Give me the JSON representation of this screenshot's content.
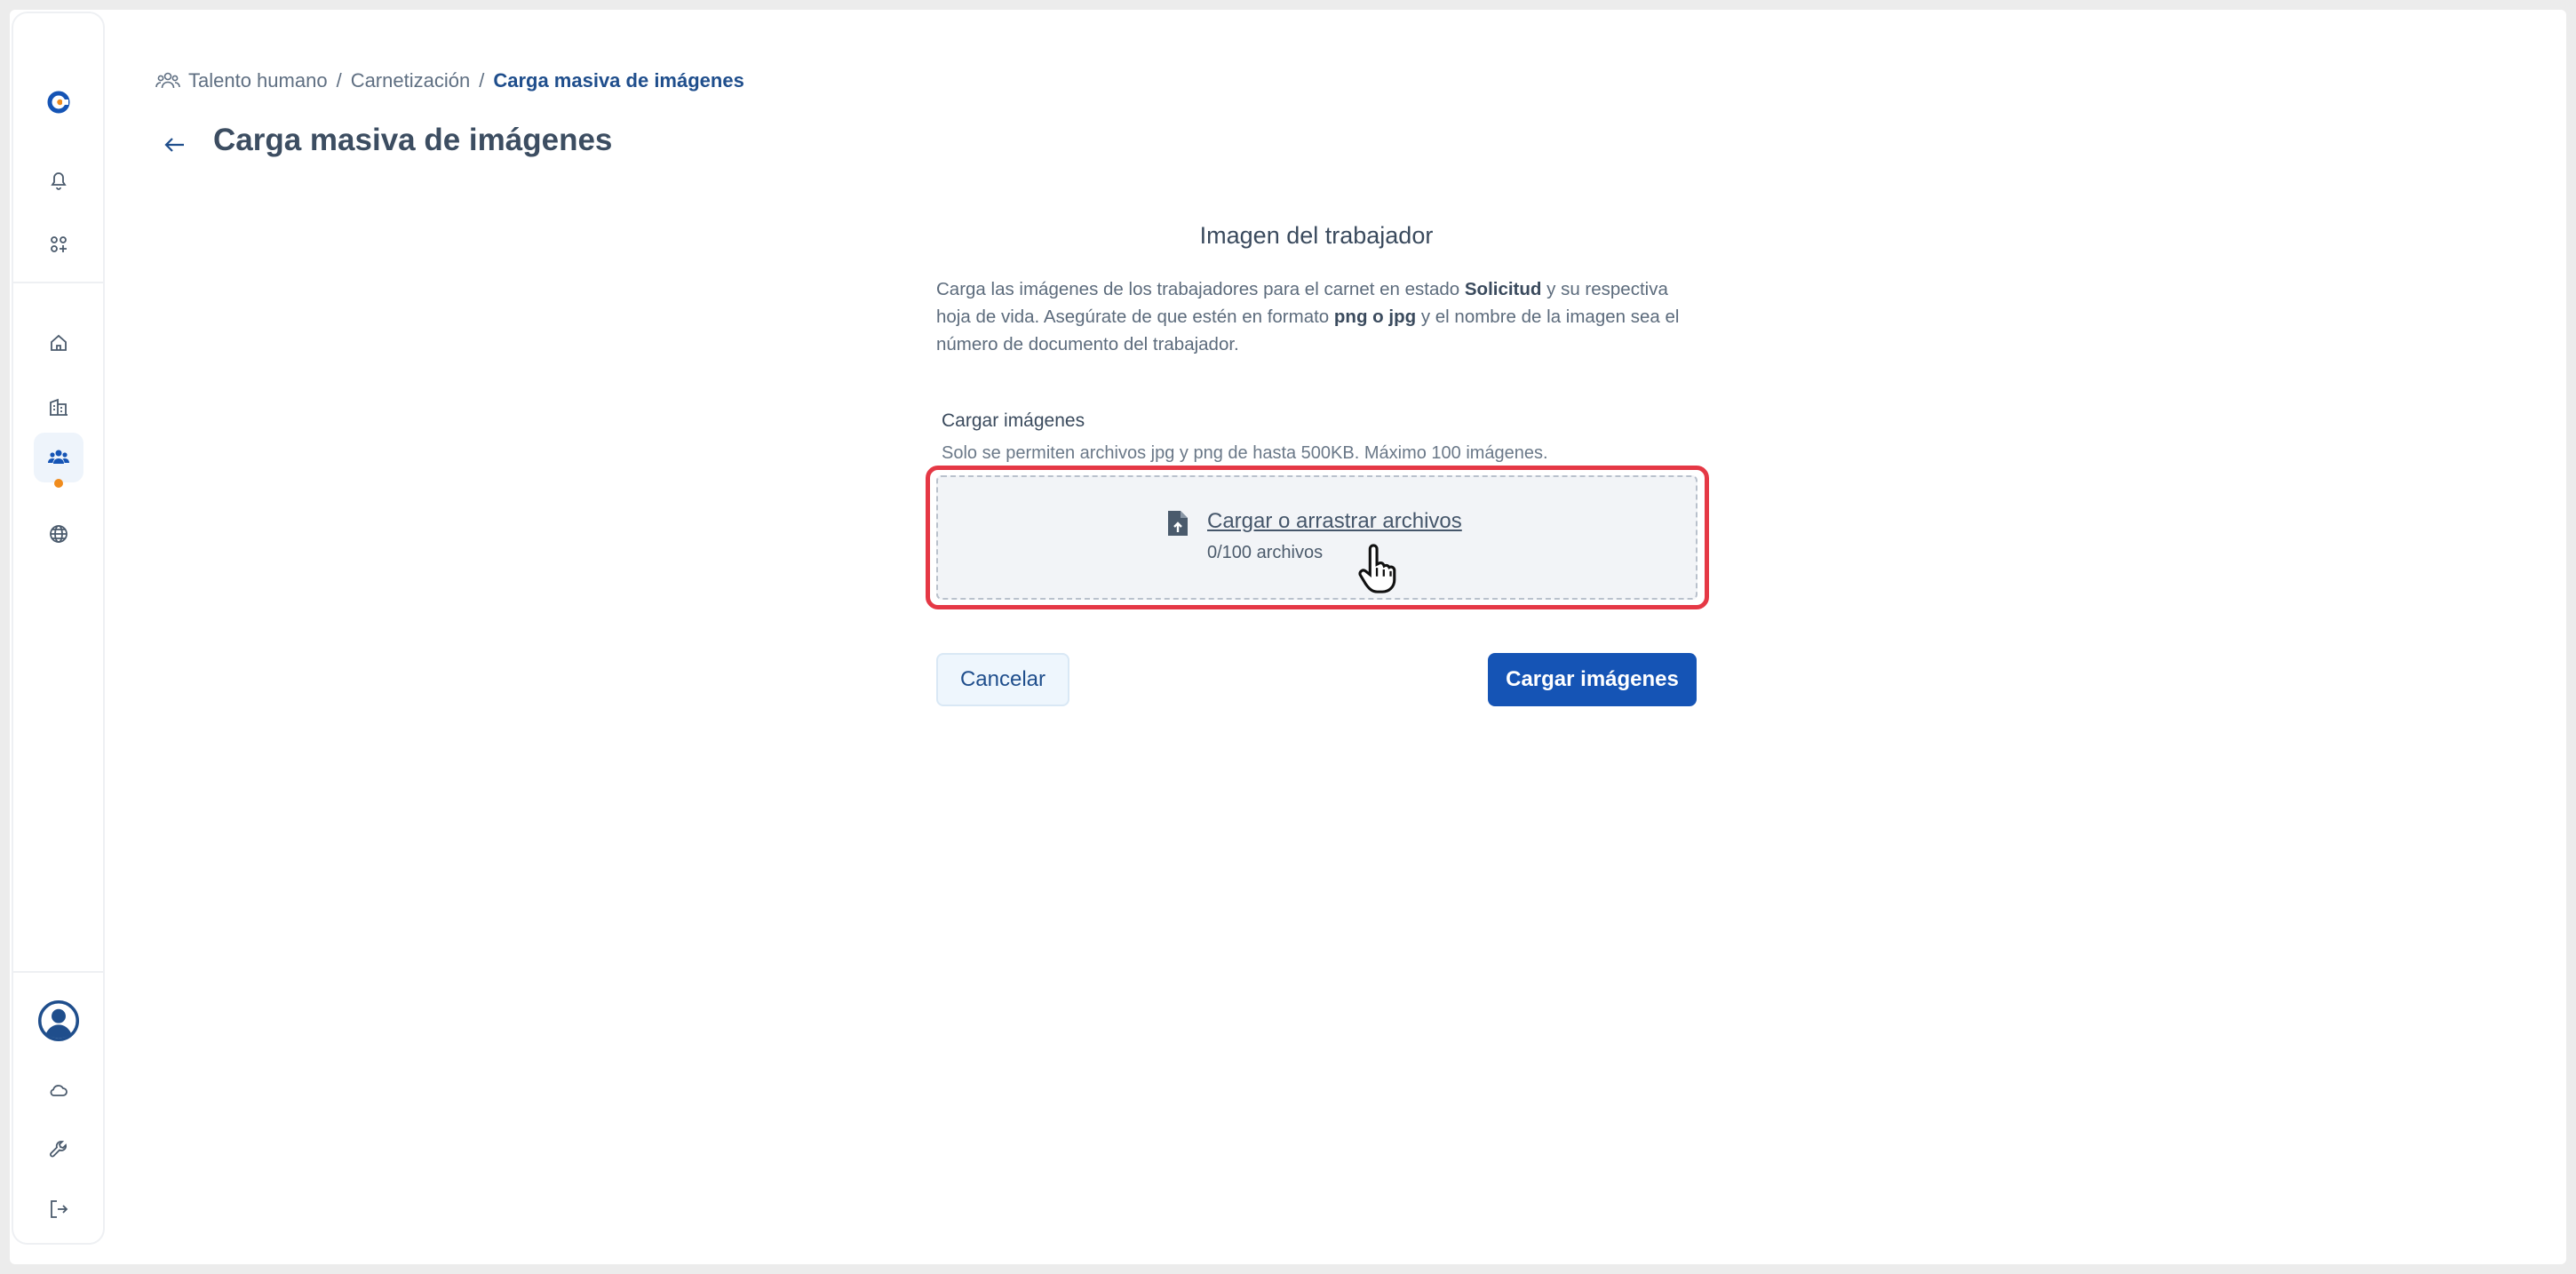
{
  "breadcrumb": {
    "items": [
      "Talento humano",
      "Carnetización"
    ],
    "current": "Carga masiva de imágenes",
    "separator": "/"
  },
  "page": {
    "title": "Carga masiva de imágenes"
  },
  "section": {
    "title": "Imagen del trabajador",
    "description": {
      "part1": "Carga las imágenes de los trabajadores para el carnet en estado ",
      "bold1": "Solicitud",
      "part2": " y su respectiva hoja de vida. Asegúrate de que estén en formato ",
      "bold2": "png o jpg",
      "part3": " y el nombre de la imagen sea el número de documento del trabajador."
    }
  },
  "upload": {
    "label": "Cargar imágenes",
    "hint": "Solo se permiten archivos jpg y png de hasta 500KB. Máximo 100 imágenes.",
    "dropzone_link": "Cargar o arrastrar archivos",
    "file_count": "0/100 archivos"
  },
  "actions": {
    "cancel_label": "Cancelar",
    "submit_label": "Cargar imágenes"
  },
  "sidebar": {
    "icons": [
      "logo-icon",
      "bell-icon",
      "apps-icon",
      "home-icon",
      "building-icon",
      "users-icon",
      "globe-icon",
      "avatar",
      "cloud-icon",
      "wrench-icon",
      "logout-icon"
    ],
    "active_item": "users-icon"
  },
  "colors": {
    "primary": "#1554b5",
    "highlight": "#e53845",
    "notification_dot": "#f08c1d",
    "breadcrumb_current": "#1f4e8c"
  }
}
